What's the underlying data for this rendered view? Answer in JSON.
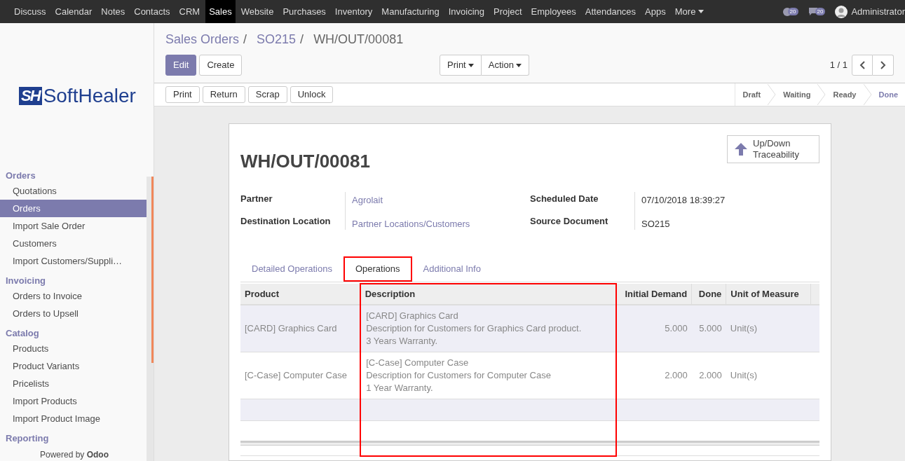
{
  "top_menu": {
    "items": [
      {
        "label": "Discuss",
        "selected": false
      },
      {
        "label": "Calendar",
        "selected": false
      },
      {
        "label": "Notes",
        "selected": false
      },
      {
        "label": "Contacts",
        "selected": false
      },
      {
        "label": "CRM",
        "selected": false
      },
      {
        "label": "Sales",
        "selected": true
      },
      {
        "label": "Website",
        "selected": false
      },
      {
        "label": "Purchases",
        "selected": false
      },
      {
        "label": "Inventory",
        "selected": false
      },
      {
        "label": "Manufacturing",
        "selected": false
      },
      {
        "label": "Invoicing",
        "selected": false
      },
      {
        "label": "Project",
        "selected": false
      },
      {
        "label": "Employees",
        "selected": false
      },
      {
        "label": "Attendances",
        "selected": false
      },
      {
        "label": "Apps",
        "selected": false
      }
    ],
    "more": "More",
    "activity_count": "20",
    "message_count": "20",
    "user": "Administrator"
  },
  "logo": {
    "mark": "SH",
    "text": "SoftHealer"
  },
  "sidebar": {
    "sections": [
      {
        "title": "Orders",
        "items": [
          {
            "label": "Quotations",
            "selected": false
          },
          {
            "label": "Orders",
            "selected": true
          },
          {
            "label": "Import Sale Order",
            "selected": false
          },
          {
            "label": "Customers",
            "selected": false
          },
          {
            "label": "Import Customers/Suppli…",
            "selected": false
          }
        ]
      },
      {
        "title": "Invoicing",
        "items": [
          {
            "label": "Orders to Invoice",
            "selected": false
          },
          {
            "label": "Orders to Upsell",
            "selected": false
          }
        ]
      },
      {
        "title": "Catalog",
        "items": [
          {
            "label": "Products",
            "selected": false
          },
          {
            "label": "Product Variants",
            "selected": false
          },
          {
            "label": "Pricelists",
            "selected": false
          },
          {
            "label": "Import Products",
            "selected": false
          },
          {
            "label": "Import Product Image",
            "selected": false
          }
        ]
      },
      {
        "title": "Reporting"
      }
    ],
    "footer": "Powered by **Odoo**"
  },
  "breadcrumb": [
    {
      "label": "Sales Orders",
      "link": true,
      "separator": "/"
    },
    {
      "label": "SO215",
      "link": true,
      "separator": "/"
    },
    {
      "label": "WH/OUT/00081",
      "link": false
    }
  ],
  "main_buttons": [
    {
      "label": "Edit",
      "primary": true
    },
    {
      "label": "Create",
      "primary": false
    }
  ],
  "dropdowns": [
    "Print",
    "Action"
  ],
  "pager": "1 / 1",
  "action_buttons": [
    "Print",
    "Return",
    "Scrap",
    "Unlock"
  ],
  "status_steps": [
    {
      "label": "Draft",
      "selected": false
    },
    {
      "label": "Waiting",
      "selected": false
    },
    {
      "label": "Ready",
      "selected": false
    },
    {
      "label": "Done",
      "selected": true
    }
  ],
  "sheet": {
    "title": "WH/OUT/00081",
    "traceability_button": "Up/Down\nTraceability",
    "fields_left": [
      {
        "label": "Partner",
        "value": "Agrolait",
        "link": true
      },
      {
        "label": "Destination Location",
        "value": "Partner Locations/Customers",
        "link": true
      }
    ],
    "fields_right": [
      {
        "label": "Scheduled Date",
        "value": "07/10/2018 18:39:27",
        "link": false
      },
      {
        "label": "Source Document",
        "value": "SO215",
        "link": false
      }
    ],
    "tabs": [
      {
        "label": "Detailed Operations",
        "selected": false,
        "highlighted": false
      },
      {
        "label": "Operations",
        "selected": true,
        "highlighted": true
      },
      {
        "label": "Additional Info",
        "selected": false,
        "highlighted": false
      }
    ],
    "table": {
      "columns": [
        "Product",
        "Description",
        "Initial Demand",
        "Done",
        "Unit of Measure"
      ],
      "rows": [
        {
          "product": "[CARD] Graphics Card",
          "description": [
            "[CARD] Graphics Card",
            "Description for Customers for Graphics Card product.",
            "3 Years Warranty."
          ],
          "initial_demand": "5.000",
          "done": "5.000",
          "uom": "Unit(s)"
        },
        {
          "product": "[C-Case] Computer Case",
          "description": [
            "[C-Case] Computer Case",
            "Description for Customers for Computer Case",
            "1 Year Warranty."
          ],
          "initial_demand": "2.000",
          "done": "2.000",
          "uom": "Unit(s)"
        }
      ],
      "description_highlighted": true
    }
  }
}
